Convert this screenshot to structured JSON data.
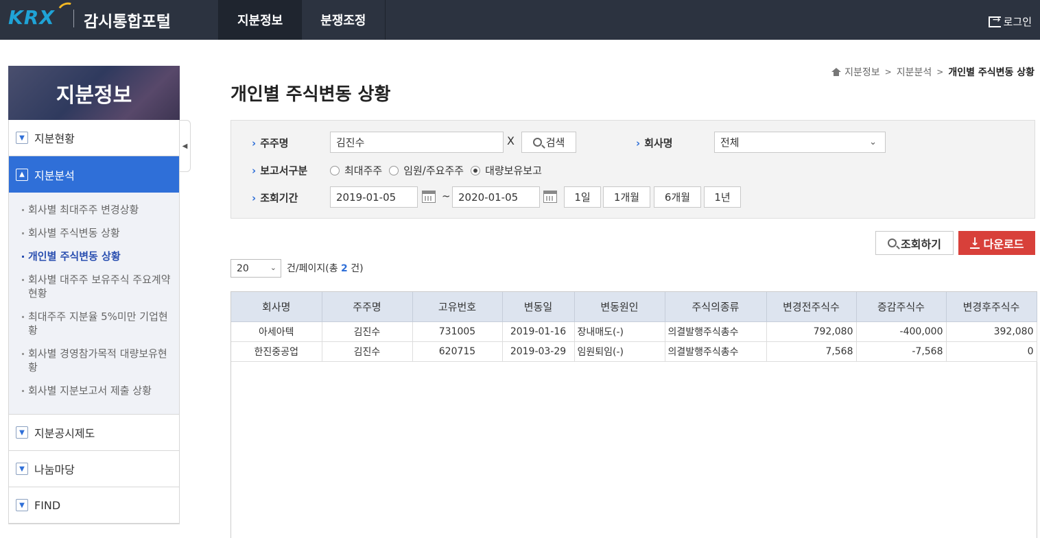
{
  "header": {
    "logo_text": "KRX",
    "portal_title": "감시통합포털",
    "nav": [
      "지분정보",
      "분쟁조정"
    ],
    "login_label": "로그인"
  },
  "sidebar": {
    "title": "지분정보",
    "menus": [
      {
        "label": "지분현황"
      },
      {
        "label": "지분분석"
      },
      {
        "label": "지분공시제도"
      },
      {
        "label": "나눔마당"
      },
      {
        "label": "FIND"
      }
    ],
    "sub_items": [
      "회사별 최대주주 변경상황",
      "회사별 주식변동 상황",
      "개인별 주식변동 상황",
      "회사별 대주주 보유주식 주요계약 현황",
      "최대주주 지분율 5%미만 기업현황",
      "회사별 경영참가목적 대량보유현황",
      "회사별 지분보고서 제출 상황"
    ]
  },
  "breadcrumb": [
    "지분정보",
    "지분분석",
    "개인별 주식변동 상황"
  ],
  "page_title": "개인별 주식변동 상황",
  "search": {
    "holder_label": "주주명",
    "holder_value": "김진수",
    "clear_label": "X",
    "search_btn": "검색",
    "company_label": "회사명",
    "company_value": "전체",
    "report_label": "보고서구분",
    "report_options": [
      "최대주주",
      "임원/주요주주",
      "대량보유보고"
    ],
    "report_selected": "대량보유보고",
    "period_label": "조회기간",
    "date_from": "2019-01-05",
    "date_tilde": "~",
    "date_to": "2020-01-05",
    "quick": [
      "1일",
      "1개월",
      "6개월",
      "1년"
    ]
  },
  "actions": {
    "query": "조회하기",
    "download": "다운로드"
  },
  "paging": {
    "page_size": "20",
    "text_before": "건/페이지(총 ",
    "total": "2",
    "text_after": " 건)"
  },
  "table": {
    "columns": [
      "회사명",
      "주주명",
      "고유번호",
      "변동일",
      "변동원인",
      "주식의종류",
      "변경전주식수",
      "증감주식수",
      "변경후주식수"
    ],
    "rows": [
      [
        "아세아텍",
        "김진수",
        "731005",
        "2019-01-16",
        "장내매도(-)",
        "의결발행주식총수",
        "792,080",
        "-400,000",
        "392,080"
      ],
      [
        "한진중공업",
        "김진수",
        "620715",
        "2019-03-29",
        "임원퇴임(-)",
        "의결발행주식총수",
        "7,568",
        "-7,568",
        "0"
      ]
    ]
  },
  "colors": {
    "topbar": "#2c3340",
    "accent": "#2f6fd8",
    "download": "#d8403a",
    "header_row": "#dde4ef"
  }
}
